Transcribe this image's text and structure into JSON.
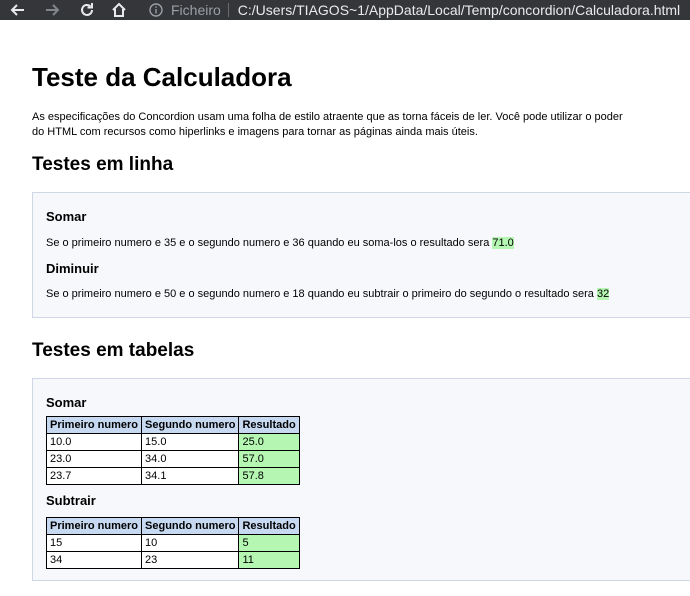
{
  "browser": {
    "scheme_label": "Ficheiro",
    "url": "C:/Users/TIAGOS~1/AppData/Local/Temp/concordion/Calculadora.html"
  },
  "page": {
    "title": "Teste da Calculadora",
    "intro": "As especificações do Concordion usam uma folha de estilo atraente que as torna fáceis de ler. Você pode utilizar o poder do HTML com recursos como hiperlinks e imagens para tornar as páginas ainda mais úteis."
  },
  "inline": {
    "heading": "Testes em linha",
    "somar": {
      "heading": "Somar",
      "text": "Se o primeiro numero e 35 e o segundo numero e 36 quando eu soma-los o resultado sera ",
      "result": "71.0"
    },
    "diminuir": {
      "heading": "Diminuir",
      "text": "Se o primeiro numero e 50 e o segundo numero e 18 quando eu subtrair o primeiro do segundo o resultado sera ",
      "result": "32"
    }
  },
  "tables": {
    "heading": "Testes em tabelas",
    "columns": [
      "Primeiro numero",
      "Segundo numero",
      "Resultado"
    ],
    "somar": {
      "heading": "Somar",
      "rows": [
        [
          "10.0",
          "15.0",
          "25.0"
        ],
        [
          "23.0",
          "34.0",
          "57.0"
        ],
        [
          "23.7",
          "34.1",
          "57.8"
        ]
      ]
    },
    "subtrair": {
      "heading": "Subtrair",
      "rows": [
        [
          "15",
          "10",
          "5"
        ],
        [
          "34",
          "23",
          "11"
        ]
      ]
    }
  },
  "colors": {
    "chrome": "#35363a",
    "pass": "#b5f7b2",
    "table_header": "#c6d9f1",
    "panel": "#f7f8fb"
  }
}
